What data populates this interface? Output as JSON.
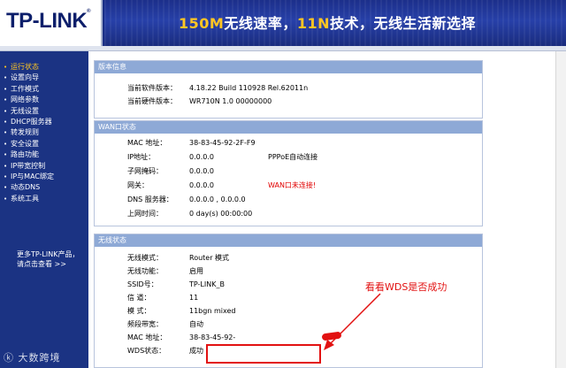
{
  "banner": {
    "logo": "TP-LINK",
    "slogan_hl1": "150M",
    "slogan_mid1": "无线速率，",
    "slogan_hl2": "11N",
    "slogan_mid2": "技术，无线生活新选择"
  },
  "sidebar": {
    "items": [
      {
        "label": "运行状态",
        "active": true
      },
      {
        "label": "设置向导"
      },
      {
        "label": "工作模式"
      },
      {
        "label": "网络参数"
      },
      {
        "label": "无线设置"
      },
      {
        "label": "DHCP服务器"
      },
      {
        "label": "转发规则"
      },
      {
        "label": "安全设置"
      },
      {
        "label": "路由功能"
      },
      {
        "label": "IP带宽控制"
      },
      {
        "label": "IP与MAC绑定"
      },
      {
        "label": "动态DNS"
      },
      {
        "label": "系统工具"
      }
    ],
    "more_line1": "更多TP-LINK产品，",
    "more_line2": "请点击查看 >>",
    "watermark": "大数跨境"
  },
  "version": {
    "title": "版本信息",
    "rows": [
      {
        "label": "当前软件版本：",
        "value": "4.18.22 Build 110928 Rel.62011n"
      },
      {
        "label": "当前硬件版本：",
        "value": "WR710N 1.0 00000000"
      }
    ]
  },
  "wan": {
    "title": "WAN口状态",
    "rows": [
      {
        "label": "MAC 地址：",
        "value": "38-83-45-92-2F-F9",
        "extra": ""
      },
      {
        "label": "IP地址：",
        "value": "0.0.0.0",
        "extra": "PPPoE自动连接"
      },
      {
        "label": "子网掩码：",
        "value": "0.0.0.0",
        "extra": ""
      },
      {
        "label": "网关：",
        "value": "0.0.0.0",
        "extra": "WAN口未连接!"
      },
      {
        "label": "DNS 服务器：",
        "value": "0.0.0.0 , 0.0.0.0",
        "extra": ""
      },
      {
        "label": "上网时间：",
        "value": "0 day(s) 00:00:00",
        "extra": ""
      }
    ]
  },
  "wireless": {
    "title": "无线状态",
    "rows": [
      {
        "label": "无线模式：",
        "value": "Router 模式"
      },
      {
        "label": "无线功能：",
        "value": "启用"
      },
      {
        "label": "SSID号：",
        "value": "TP-LINK_B"
      },
      {
        "label": "信 道：",
        "value": "11"
      },
      {
        "label": "模 式：",
        "value": "11bgn mixed"
      },
      {
        "label": "频段带宽：",
        "value": "自动"
      },
      {
        "label": "MAC 地址：",
        "value": "38-83-45-92-"
      },
      {
        "label": "WDS状态：",
        "value": "成功"
      }
    ]
  },
  "annotation": "看看WDS是否成功",
  "colors": {
    "sidebar_bg": "#1b3383",
    "panel_header": "#8ea9d6",
    "accent_yellow": "#ffc623",
    "annotation_red": "#e21111"
  }
}
